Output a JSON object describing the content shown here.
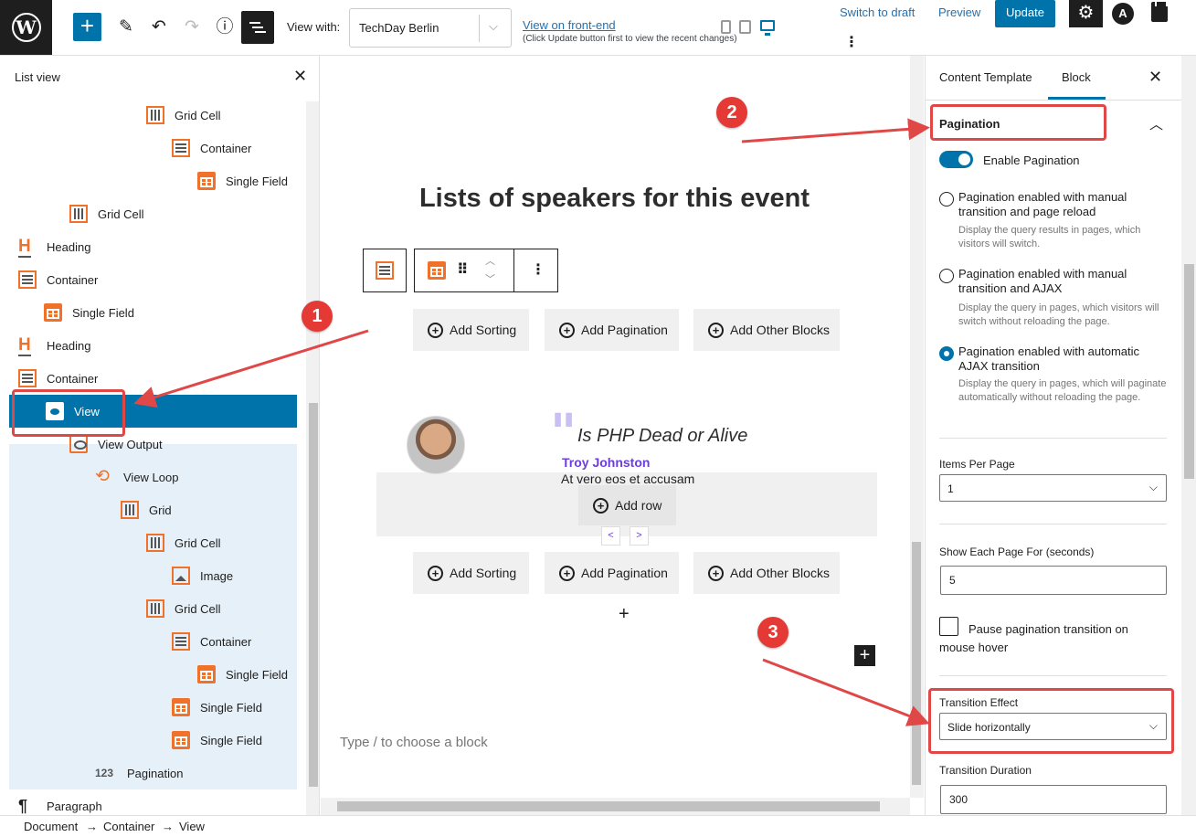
{
  "toolbar": {
    "view_with_label": "View with:",
    "view_with_value": "TechDay Berlin",
    "frontend_link": "View on front-end",
    "frontend_note": "(Click Update button first to view the recent changes)",
    "switch_draft": "Switch to draft",
    "preview": "Preview",
    "update": "Update",
    "icons": [
      "wordpress-logo",
      "add",
      "pencil",
      "undo",
      "redo",
      "info",
      "list-view",
      "mobile",
      "tablet",
      "desktop",
      "more-vertical",
      "gear",
      "astra",
      "clipboard"
    ]
  },
  "list_view": {
    "title": "List view",
    "items": [
      {
        "label": "Grid Cell",
        "icon": "grid-cell"
      },
      {
        "label": "Container",
        "icon": "container"
      },
      {
        "label": "Single Field",
        "icon": "single-field"
      },
      {
        "label": "Grid Cell",
        "icon": "grid-cell"
      },
      {
        "label": "Heading",
        "icon": "heading"
      },
      {
        "label": "Container",
        "icon": "container"
      },
      {
        "label": "Single Field",
        "icon": "single-field"
      },
      {
        "label": "Heading",
        "icon": "heading"
      },
      {
        "label": "Container",
        "icon": "container"
      },
      {
        "label": "View",
        "icon": "view",
        "selected": true
      },
      {
        "label": "View Output",
        "icon": "view-output"
      },
      {
        "label": "View Loop",
        "icon": "view-loop"
      },
      {
        "label": "Grid",
        "icon": "grid"
      },
      {
        "label": "Grid Cell",
        "icon": "grid-cell"
      },
      {
        "label": "Image",
        "icon": "image"
      },
      {
        "label": "Grid Cell",
        "icon": "grid-cell"
      },
      {
        "label": "Container",
        "icon": "container"
      },
      {
        "label": "Single Field",
        "icon": "single-field"
      },
      {
        "label": "Single Field",
        "icon": "single-field"
      },
      {
        "label": "Single Field",
        "icon": "single-field"
      },
      {
        "label": "Pagination",
        "icon": "pagination"
      },
      {
        "label": "Paragraph",
        "icon": "paragraph"
      }
    ]
  },
  "canvas": {
    "heading": "Lists of speakers for this event",
    "add_sorting": "Add Sorting",
    "add_pagination": "Add Pagination",
    "add_other_blocks": "Add Other Blocks",
    "talk_title": "Is PHP Dead or Alive",
    "speaker_name": "Troy Johnston",
    "speaker_desc": "At vero eos et accusam",
    "add_row": "Add row",
    "prev": "<",
    "next": ">",
    "type_placeholder": "Type / to choose a block"
  },
  "sidebar": {
    "tab_content_template": "Content Template",
    "tab_block": "Block",
    "pagination_title": "Pagination",
    "enable_pagination": "Enable Pagination",
    "enable_pagination_on": true,
    "options": [
      {
        "label": "Pagination enabled with manual transition and page reload",
        "help": "Display the query results in pages, which visitors will switch.",
        "checked": false
      },
      {
        "label": "Pagination enabled with manual transition and AJAX",
        "help": "Display the query in pages, which visitors will switch without reloading the page.",
        "checked": false
      },
      {
        "label": "Pagination enabled with automatic AJAX transition",
        "help": "Display the query in pages, which will paginate automatically without reloading the page.",
        "checked": true
      }
    ],
    "items_per_page_label": "Items Per Page",
    "items_per_page_value": "1",
    "show_each_page_label": "Show Each Page For (seconds)",
    "show_each_page_value": "5",
    "pause_label": "Pause pagination transition on mouse hover",
    "pause_checked": false,
    "transition_effect_label": "Transition Effect",
    "transition_effect_value": "Slide horizontally",
    "transition_duration_label": "Transition Duration",
    "transition_duration_value": "300"
  },
  "breadcrumb": [
    "Document",
    "Container",
    "View"
  ],
  "breadcrumb_separator": "→",
  "annotations": [
    "1",
    "2",
    "3"
  ],
  "colors": {
    "accent": "#0073aa",
    "annotation": "#e53935",
    "field_icon": "#f0712a",
    "speaker": "#6c3ce1"
  }
}
